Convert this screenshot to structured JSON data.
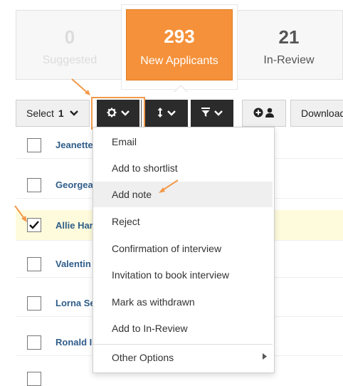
{
  "stats": {
    "suggested": {
      "count": "0",
      "label": "Suggested"
    },
    "new_applicants": {
      "count": "293",
      "label": "New Applicants"
    },
    "in_review": {
      "count": "21",
      "label": "In-Review"
    }
  },
  "toolbar": {
    "select_label": "Select",
    "select_count": "1",
    "download_label": "Download"
  },
  "applicants": [
    {
      "name": "Jeanette"
    },
    {
      "name": "Georgea"
    },
    {
      "name": "Allie Har"
    },
    {
      "name": "Valentin"
    },
    {
      "name": "Lorna Se"
    },
    {
      "name": "Ronald I"
    }
  ],
  "menu": {
    "items": [
      {
        "label": "Email"
      },
      {
        "label": "Add to shortlist"
      },
      {
        "label": "Add note"
      },
      {
        "label": "Reject"
      },
      {
        "label": "Confirmation of interview"
      },
      {
        "label": "Invitation to book interview"
      },
      {
        "label": "Mark as withdrawn"
      },
      {
        "label": "Add to In-Review"
      },
      {
        "label": "Other Options"
      }
    ]
  },
  "colors": {
    "accent": "#f5913a",
    "toolbar_dark": "#2b2b2b",
    "name_link": "#2f5d8a",
    "highlight_row": "#fefbdc"
  }
}
